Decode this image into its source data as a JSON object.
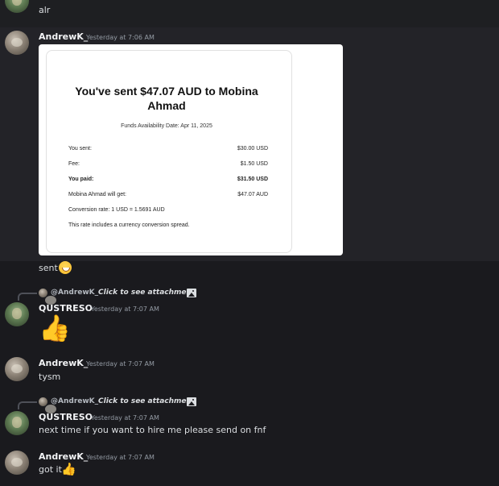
{
  "messages": {
    "m0": {
      "text": "alr"
    },
    "m1": {
      "author": "AndrewK_",
      "timestamp": "Yesterday at 7:06 AM",
      "receipt": {
        "title": "You've sent $47.07 AUD to Mobina Ahmad",
        "availability": "Funds Availability Date: Apr 11, 2025",
        "rows": [
          {
            "label": "You sent:",
            "value": "$30.00 USD"
          },
          {
            "label": "Fee:",
            "value": "$1.50 USD"
          },
          {
            "label": "You paid:",
            "value": "$31.50 USD"
          },
          {
            "label": "Mobina Ahmad will get:",
            "value": "$47.07 AUD"
          }
        ],
        "conversion": "Conversion rate: 1 USD = 1.5691 AUD",
        "note": "This rate includes a currency conversion spread."
      },
      "followup": "sent"
    },
    "m2": {
      "reply_user": "@AndrewK_",
      "reply_text": "Click to see attachment",
      "author": "QUSTRESO",
      "timestamp": "Yesterday at 7:07 AM",
      "emoji": "👍"
    },
    "m3": {
      "author": "AndrewK_",
      "timestamp": "Yesterday at 7:07 AM",
      "text": "tysm"
    },
    "m4": {
      "reply_user": "@AndrewK_",
      "reply_text": "Click to see attachment",
      "author": "QUSTRESO",
      "timestamp": "Yesterday at 7:07 AM",
      "text": "next time if you want to hire me please send on fnf"
    },
    "m5": {
      "author": "AndrewK_",
      "timestamp": "Yesterday at 7:07 AM",
      "text": "got it",
      "emoji": "👍"
    }
  },
  "colors": {
    "background": "#1a1a1e",
    "hover_row": "#232328",
    "accent_thumb": "#f7c23a"
  }
}
